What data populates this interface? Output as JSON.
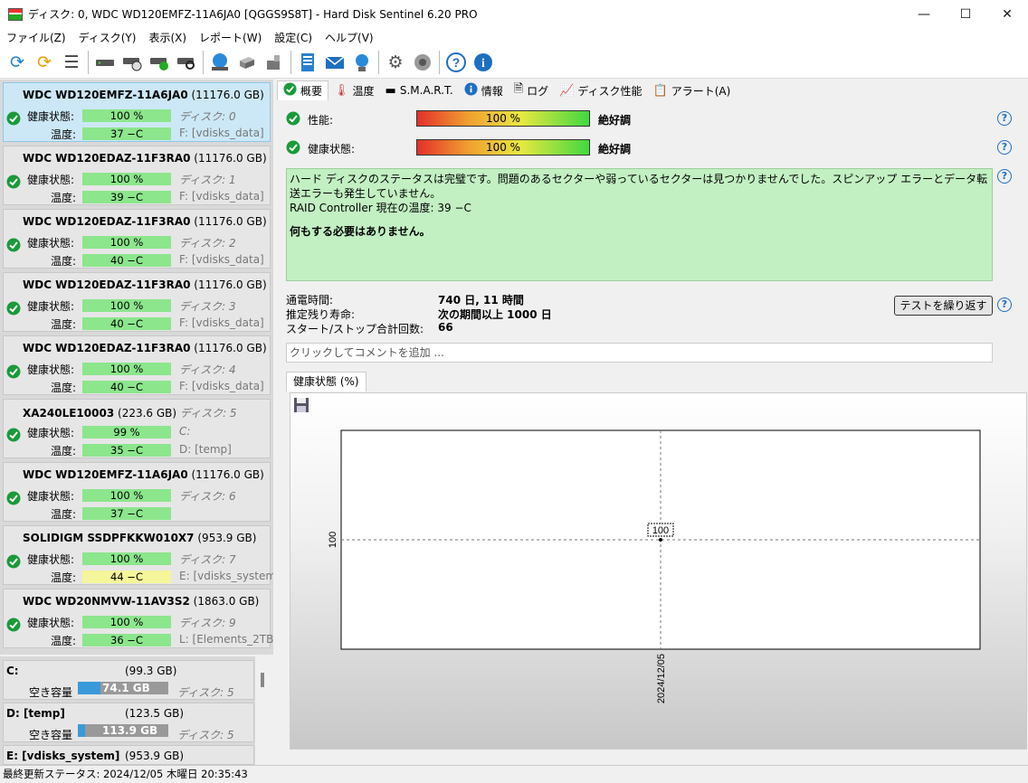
{
  "window": {
    "title": "ディスク: 0, WDC WD120EMFZ-11A6JA0 [QGGS9S8T]  -  Hard Disk Sentinel 6.20 PRO"
  },
  "menu": [
    "ファイル(Z)",
    "ディスク(Y)",
    "表示(X)",
    "レポート(W)",
    "設定(C)",
    "ヘルプ(V)"
  ],
  "labels": {
    "health": "健康状態:",
    "temp": "温度:"
  },
  "disks": [
    {
      "model": "WDC WD120EMFZ-11A6JA0",
      "size": "(11176.0 GB)",
      "health": "100 %",
      "temp": "37 −C",
      "disk": "ディスク: 0",
      "drive": "F: [vdisks_data]"
    },
    {
      "model": "WDC WD120EDAZ-11F3RA0",
      "size": "(11176.0 GB)",
      "health": "100 %",
      "temp": "39 −C",
      "disk": "ディスク: 1",
      "drive": "F: [vdisks_data]"
    },
    {
      "model": "WDC WD120EDAZ-11F3RA0",
      "size": "(11176.0 GB)",
      "health": "100 %",
      "temp": "40 −C",
      "disk": "ディスク: 2",
      "drive": "F: [vdisks_data]"
    },
    {
      "model": "WDC WD120EDAZ-11F3RA0",
      "size": "(11176.0 GB)",
      "health": "100 %",
      "temp": "40 −C",
      "disk": "ディスク: 3",
      "drive": "F: [vdisks_data]"
    },
    {
      "model": "WDC WD120EDAZ-11F3RA0",
      "size": "(11176.0 GB)",
      "health": "100 %",
      "temp": "40 −C",
      "disk": "ディスク: 4",
      "drive": "F: [vdisks_data]"
    },
    {
      "model": "XA240LE10003",
      "size": "(223.6 GB)",
      "disk_inline": "ディスク: 5",
      "health": "99 %",
      "temp": "35 −C",
      "disk": "C:",
      "drive": "D: [temp]"
    },
    {
      "model": "WDC WD120EMFZ-11A6JA0",
      "size": "(11176.0 GB)",
      "health": "100 %",
      "temp": "37 −C",
      "disk": "ディスク: 6",
      "drive": ""
    },
    {
      "model": "SOLIDIGM SSDPFKKW010X7",
      "size": "(953.9 GB)",
      "health": "100 %",
      "temp": "44 −C",
      "disk": "ディスク: 7",
      "drive": "E: [vdisks_system]"
    },
    {
      "model": "WDC WD20NMVW-11AV3S2",
      "size": "(1863.0 GB)",
      "health": "100 %",
      "temp": "36 −C",
      "disk": "ディスク: 9",
      "drive": "L: [Elements_2TB]"
    }
  ],
  "volumes": [
    {
      "name": "C:",
      "size": "(99.3 GB)",
      "free_label": "空き容量",
      "free": "74.1 GB",
      "free_fraction": 0.25,
      "disk": "ディスク: 5"
    },
    {
      "name": "D: [temp]",
      "size": "(123.5 GB)",
      "free_label": "空き容量",
      "free": "113.9 GB",
      "free_fraction": 0.08,
      "disk": "ディスク: 5"
    },
    {
      "name": "E: [vdisks_system]",
      "size": "(953.9 GB)"
    }
  ],
  "tabs": [
    "概要",
    "温度",
    "S.M.A.R.T.",
    "情報",
    "ログ",
    "ディスク性能",
    "アラート(A)"
  ],
  "overview": {
    "performance_label": "性能:",
    "performance_value": "100 %",
    "performance_text": "絶好調",
    "health_label": "健康状態:",
    "health_value": "100 %",
    "health_text": "絶好調",
    "status_line1": "ハード ディスクのステータスは完璧です。問題のあるセクターや弱っているセクターは見つかりませんでした。スピンアップ エラーとデータ転送エラーも発生していません。",
    "status_line2": "RAID Controller 現在の温度: 39 −C",
    "status_action": "何もする必要はありません。",
    "power_on_label": "通電時間:",
    "power_on_value": "740 日, 11 時間",
    "lifetime_label": "推定残り寿命:",
    "lifetime_value": "次の期間以上 1000 日",
    "startstop_label": "スタート/ストップ合計回数:",
    "startstop_value": "66",
    "repeat_test": "テストを繰り返す",
    "comment_placeholder": "クリックしてコメントを追加 ...",
    "chart_tab": "健康状態 (%)"
  },
  "chart_data": {
    "type": "line",
    "x": [
      "2024/12/05"
    ],
    "series": [
      {
        "values": [
          100
        ]
      }
    ],
    "ylabel": "",
    "yticks": [
      "100"
    ],
    "data_labels": [
      "100"
    ]
  },
  "statusbar": {
    "text": "最終更新ステータス: 2024/12/05 木曜日 20:35:43"
  }
}
